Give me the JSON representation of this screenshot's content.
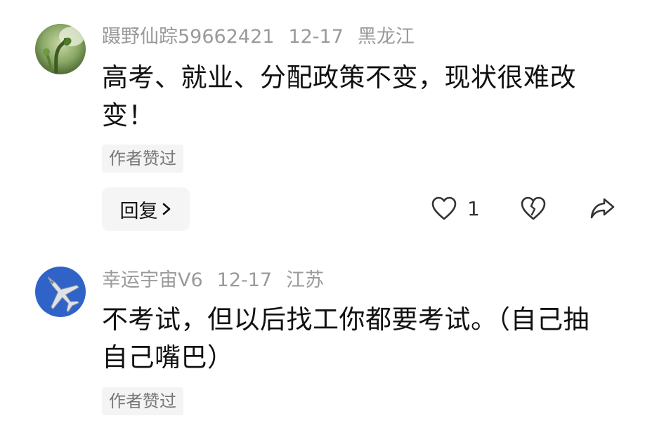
{
  "comments": [
    {
      "username": "蹑野仙踪59662421",
      "date": "12-17",
      "location": "黑龙江",
      "text": "高考、就业、分配政策不变，现状很难改变！",
      "badge": "作者赞过",
      "reply_label": "回复",
      "like_count": "1",
      "avatar_icon": "plant-sprout-avatar"
    },
    {
      "username": "幸运宇宙V6",
      "date": "12-17",
      "location": "江苏",
      "text": "不考试，但以后找工你都要考试。（自己抽自己嘴巴）",
      "badge": "作者赞过",
      "avatar_icon": "fighter-jet-avatar"
    }
  ],
  "colors": {
    "meta_text": "#9a9a9a",
    "badge_bg": "#f4f4f4",
    "reply_bg": "#f5f5f5",
    "avatar2_bg": "#2f63c8",
    "avatar1_bg": "#6a8f4a"
  }
}
